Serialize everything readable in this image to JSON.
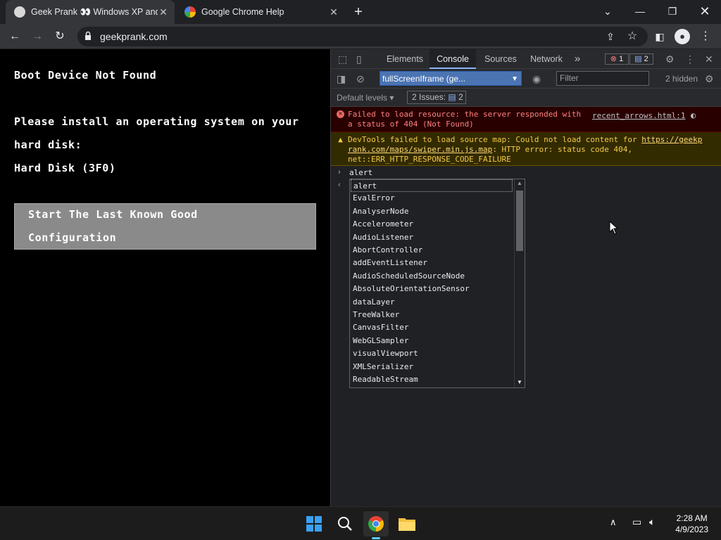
{
  "browser": {
    "tabs": [
      {
        "title": "Geek Prank 👀 Windows XP and",
        "active": true
      },
      {
        "title": "Google Chrome Help",
        "active": false
      }
    ],
    "url": "geekprank.com"
  },
  "page": {
    "line1": "Boot Device Not Found",
    "line2": "Please install an operating system on your",
    "line3": "hard disk:",
    "line4": "Hard Disk (3F0)",
    "button_line1": "Start The Last Known Good",
    "button_line2": "Configuration"
  },
  "devtools": {
    "tabs": [
      "Elements",
      "Console",
      "Sources",
      "Network"
    ],
    "more_tabs": "»",
    "error_count": "1",
    "issue_count": "2",
    "context": "fullScreenIframe (ge...",
    "filter_placeholder": "Filter",
    "hidden": "2 hidden",
    "default_levels": "Default levels",
    "issues_label": "2 Issues:",
    "issues_count": "2",
    "error_msg_line1": "Failed to load resource: the server responded with",
    "error_msg_line2": "a status of 404 (Not Found)",
    "error_source": "recent_arrows.html:1",
    "warn_prefix": "DevTools failed to load source map: Could not load content for ",
    "warn_link_a": "https://geekp",
    "warn_link_b": "rank.com/maps/swiper.min.js.map",
    "warn_suffix": ": HTTP error: status code 404,",
    "warn_line3": "net::ERR_HTTP_RESPONSE_CODE_FAILURE",
    "prompt_text": "alert",
    "autocomplete": [
      "alert",
      "EvalError",
      "AnalyserNode",
      "Accelerometer",
      "AudioListener",
      "AbortController",
      "addEventListener",
      "AudioScheduledSourceNode",
      "AbsoluteOrientationSensor",
      "dataLayer",
      "TreeWalker",
      "CanvasFilter",
      "WebGLSampler",
      "visualViewport",
      "XMLSerializer",
      "ReadableStream"
    ]
  },
  "taskbar": {
    "time": "2:28 AM",
    "date": "4/9/2023"
  },
  "colors": {
    "accent": "#8ab4f8",
    "error": "#ff8080",
    "warning": "#f2c94c"
  }
}
